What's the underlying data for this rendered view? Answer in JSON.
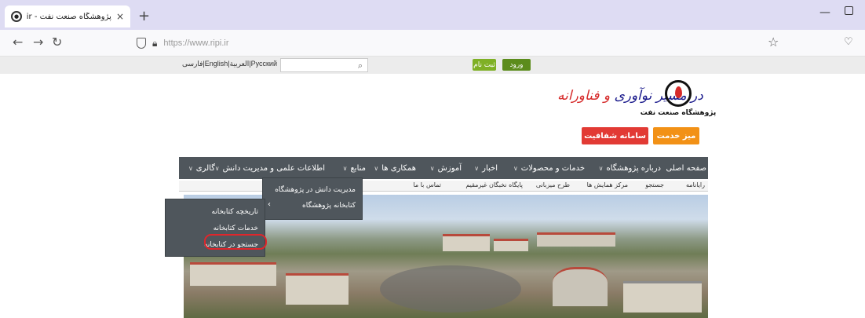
{
  "browser": {
    "tab_title": "پژوهشگاه صنعت نفت - ripi.ir",
    "tab_close": "×",
    "new_tab": "+",
    "url": "https://www.ripi.ir",
    "icons": [
      "back-icon",
      "forward-icon",
      "reload-icon",
      "shield-icon",
      "lock-icon",
      "star-icon",
      "pocket-icon"
    ]
  },
  "topbar": {
    "languages": "فارسی|English|العربية|Русский",
    "search_placeholder": "",
    "register": "ثبت نام",
    "login": "ورود"
  },
  "header": {
    "org_name": "پژوهشگاه صنعت نفت",
    "slogan_a": "در مسیر نوآوری",
    "slogan_b": " و فناورانه",
    "btn_transparency": "سامانه شفافیت",
    "btn_service_desk": "میز خدمت"
  },
  "menu": {
    "items": [
      {
        "label": "صفحه اصلی",
        "chev": ""
      },
      {
        "label": "درباره پژوهشگاه",
        "chev": "∨"
      },
      {
        "label": "خدمات و محصولات",
        "chev": "∨"
      },
      {
        "label": "اخبار",
        "chev": "∨"
      },
      {
        "label": "آموزش",
        "chev": "∨"
      },
      {
        "label": "همکاری ها",
        "chev": "∨"
      },
      {
        "label": "منابع",
        "chev": "∨"
      },
      {
        "label": "اطلاعات علمی و مدیریت دانش",
        "chev": "∨"
      },
      {
        "label": "گالری",
        "chev": "∨"
      }
    ]
  },
  "subbar": {
    "items": [
      "رایانامه",
      "جستجو",
      "مرکز همایش ها",
      "طرح میزبانی",
      "پایگاه نخبگان غیرمقیم",
      "تماس با ما"
    ]
  },
  "dropdown_knowledge": {
    "items": [
      "مدیریت دانش در پژوهشگاه",
      "کتابخانه پژوهشگاه"
    ],
    "submenu_chev": "‹"
  },
  "dropdown_library": {
    "items": [
      "تاریخچه کتابخانه",
      "خدمات کتابخانه",
      "جستجو در کتابخانه"
    ]
  }
}
